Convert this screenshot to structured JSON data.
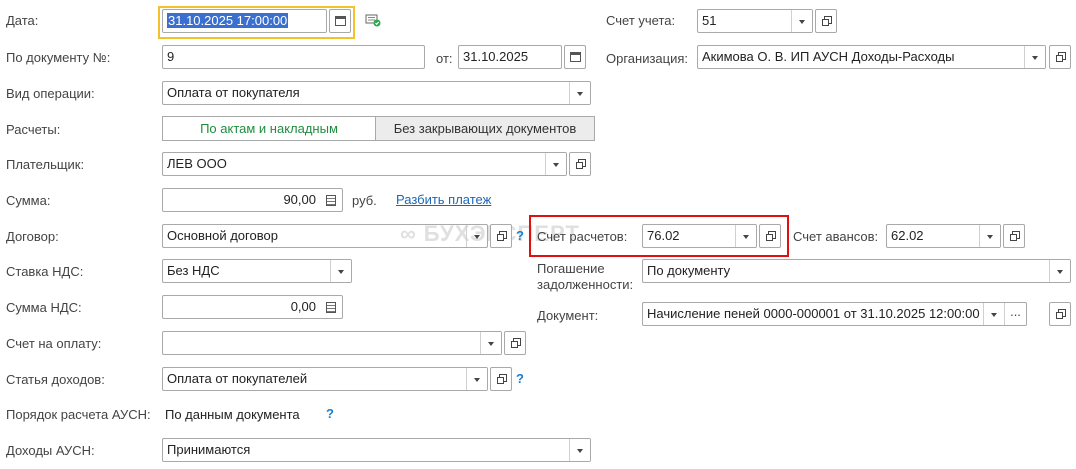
{
  "labels": {
    "date": "Дата:",
    "doc_no": "По документу №:",
    "from": "от:",
    "operation": "Вид операции:",
    "settlements": "Расчеты:",
    "payer": "Плательщик:",
    "amount": "Сумма:",
    "rub": "руб.",
    "contract": "Договор:",
    "vat_rate": "Ставка НДС:",
    "vat_amount": "Сумма НДС:",
    "invoice": "Счет на оплату:",
    "income_item": "Статья доходов:",
    "ausn_order": "Порядок расчета АУСН:",
    "ausn_income": "Доходы АУСН:",
    "account": "Счет учета:",
    "organization": "Организация:",
    "settle_account": "Счет расчетов:",
    "advance_account": "Счет авансов:",
    "repayment_1": "Погашение",
    "repayment_2": "задолженности:",
    "document": "Документ:"
  },
  "values": {
    "date": "31.10.2025 17:00:00",
    "doc_no": "9",
    "from_date": "31.10.2025",
    "operation": "Оплата от покупателя",
    "settle_tab_1": "По актам и накладным",
    "settle_tab_2": "Без закрывающих документов",
    "payer": "ЛЕВ ООО",
    "amount": "90,00",
    "split_link": "Разбить платеж",
    "contract": "Основной договор",
    "vat_rate": "Без НДС",
    "vat_amount": "0,00",
    "invoice": "",
    "income_item": "Оплата от покупателей",
    "ausn_order": "По данным документа",
    "ausn_income": "Принимаются",
    "account": "51",
    "organization": "Акимова О. В. ИП АУСН Доходы-Расходы",
    "settle_account": "76.02",
    "advance_account": "62.02",
    "repayment": "По документу",
    "document": "Начисление пеней 0000-000001 от 31.10.2025 12:00:00"
  },
  "help_mark": "?",
  "ellipsis": "...",
  "colors": {
    "highlight_red": "#e01010",
    "highlight_yellow": "#f3c12b",
    "active_tab_text": "#1e8e3e",
    "link": "#1b67b5",
    "help": "#1a7ed0"
  }
}
